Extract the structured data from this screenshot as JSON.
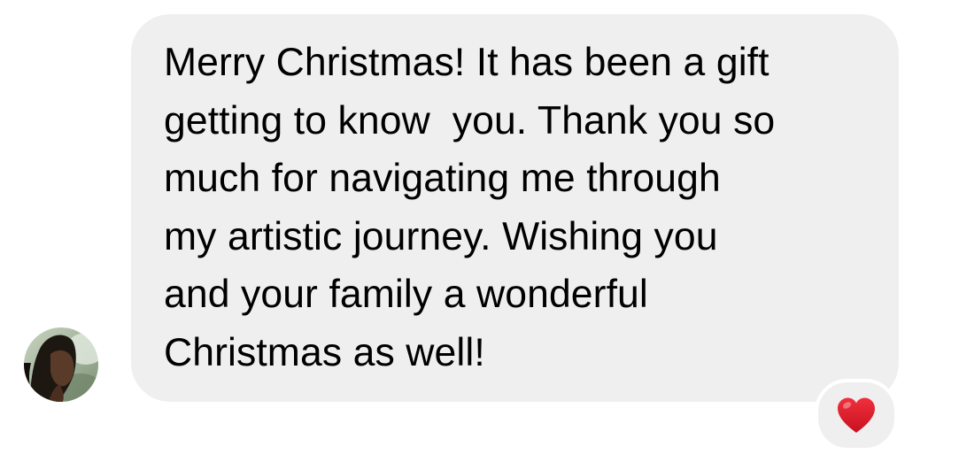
{
  "conversation": {
    "message": {
      "line_1": "Merry Christmas! It has been a gift",
      "line_2": "getting to know  you. Thank you so",
      "line_3": "much for navigating me through",
      "line_4": "my artistic journey. Wishing you",
      "line_5": "and your family a wonderful",
      "line_6": "Christmas as well!"
    },
    "reaction": {
      "icon": "heart-icon",
      "color": "#e0142b"
    },
    "bubble_color": "#efefef"
  }
}
